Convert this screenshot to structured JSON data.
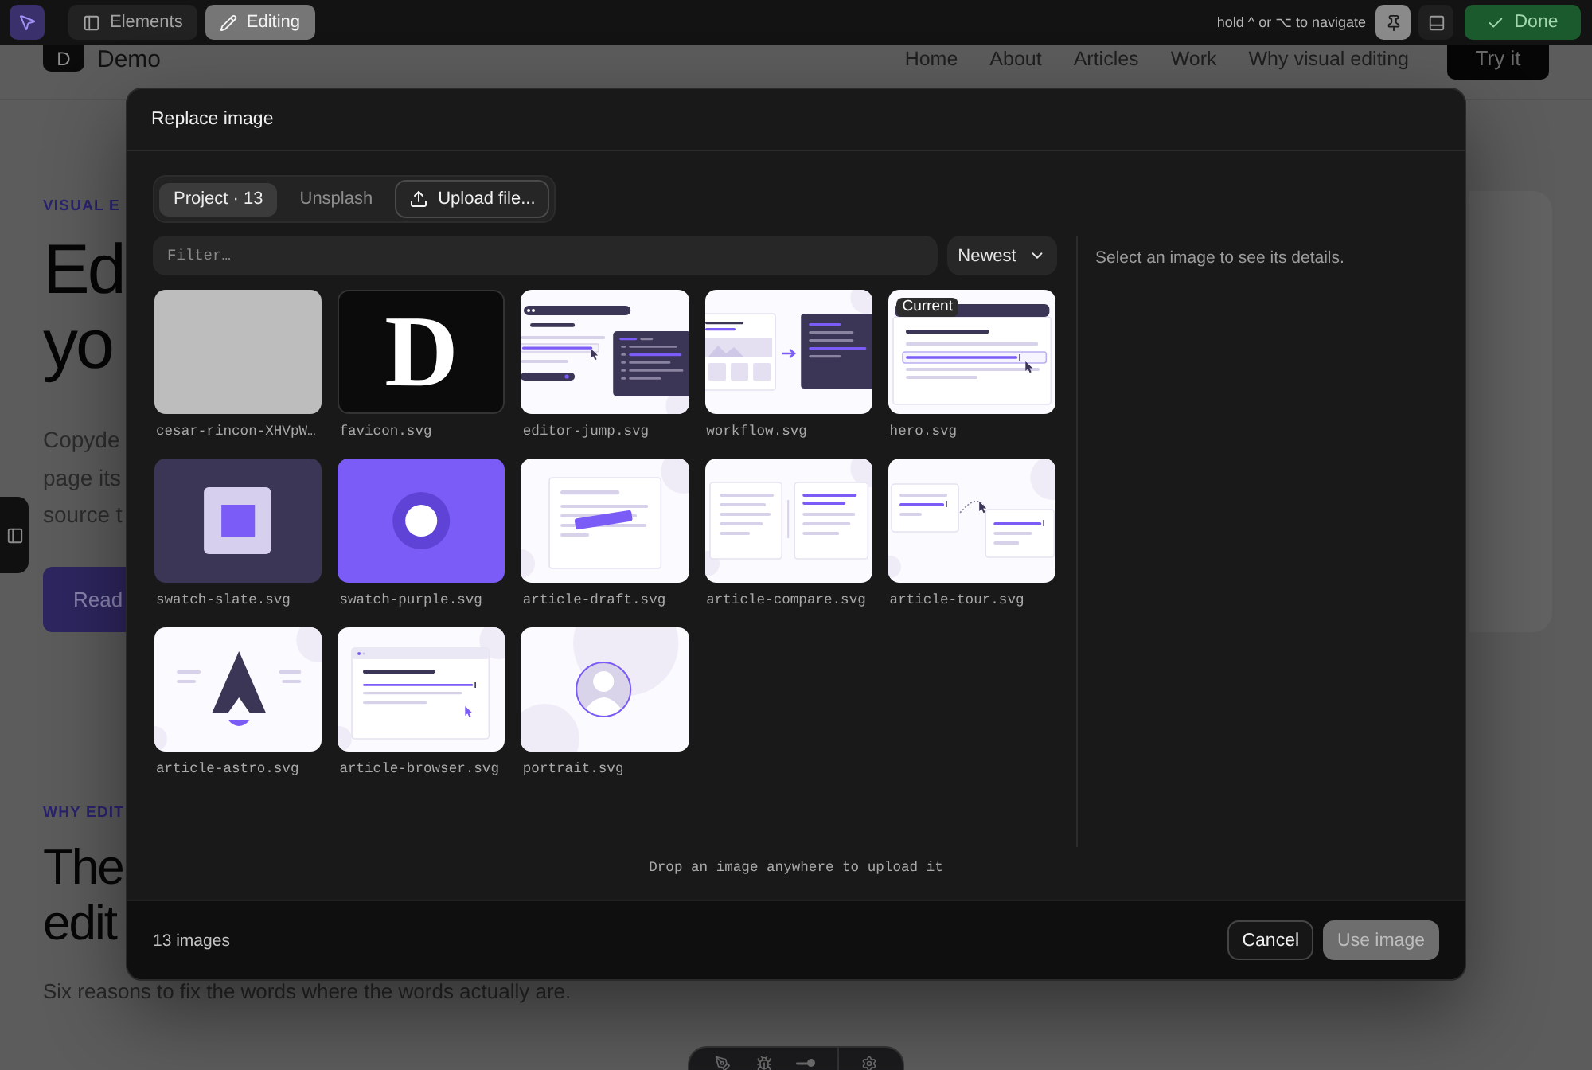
{
  "toolbar": {
    "pointer_tool": {
      "active": true
    },
    "modes": [
      {
        "label": "Elements",
        "selected": false
      },
      {
        "label": "Editing",
        "selected": true
      }
    ],
    "hint": "hold ^ or ⌥ to navigate",
    "pin": {
      "on": true
    },
    "done": "Done"
  },
  "page": {
    "logo": "D",
    "site": "Demo",
    "nav": [
      "Home",
      "About",
      "Articles",
      "Work",
      "Why visual editing"
    ],
    "cta": "Try it",
    "hero": {
      "eyebrow": "VISUAL E",
      "title_lines": [
        "Ed",
        "yo"
      ],
      "text_lines": [
        "Copyde",
        "page its",
        "source t"
      ],
      "button": "Read"
    },
    "section": {
      "eyebrow": "WHY EDIT",
      "title_lines": [
        "The",
        "edit"
      ],
      "text": "Six reasons to fix the words where the words actually are."
    }
  },
  "dialog": {
    "title": "Replace image",
    "sources": [
      {
        "label": "Project · 13",
        "selected": true
      },
      {
        "label": "Unsplash",
        "selected": false
      }
    ],
    "upload": "Upload file...",
    "filter": {
      "placeholder": "Filter…"
    },
    "sort": {
      "value": "Newest"
    },
    "images": [
      {
        "file": "cesar-rincon-XHVpW…",
        "kind": "photo",
        "selected": false
      },
      {
        "file": "favicon.svg",
        "kind": "letter",
        "letter": "D",
        "selected": false
      },
      {
        "file": "editor-jump.svg",
        "kind": "editor",
        "selected": false
      },
      {
        "file": "workflow.svg",
        "kind": "workflow",
        "selected": false
      },
      {
        "file": "hero.svg",
        "kind": "hero",
        "badge": "Current",
        "selected": false
      },
      {
        "file": "swatch-slate.svg",
        "kind": "swatch_square",
        "selected": false
      },
      {
        "file": "swatch-purple.svg",
        "kind": "swatch_circle",
        "selected": false
      },
      {
        "file": "article-draft.svg",
        "kind": "draft",
        "selected": false
      },
      {
        "file": "article-compare.svg",
        "kind": "compare",
        "selected": false
      },
      {
        "file": "article-tour.svg",
        "kind": "tour",
        "selected": false
      },
      {
        "file": "article-astro.svg",
        "kind": "astro",
        "selected": false
      },
      {
        "file": "article-browser.svg",
        "kind": "browser",
        "selected": false
      },
      {
        "file": "portrait.svg",
        "kind": "portrait",
        "selected": false
      }
    ],
    "details_hint": "Select an image to see its details.",
    "drop_hint": "Drop an image anywhere to upload it",
    "count": "13 images",
    "buttons": [
      {
        "label": "Cancel",
        "kind": "secondary",
        "disabled": false
      },
      {
        "label": "Use image",
        "kind": "primary",
        "disabled": true
      }
    ]
  }
}
